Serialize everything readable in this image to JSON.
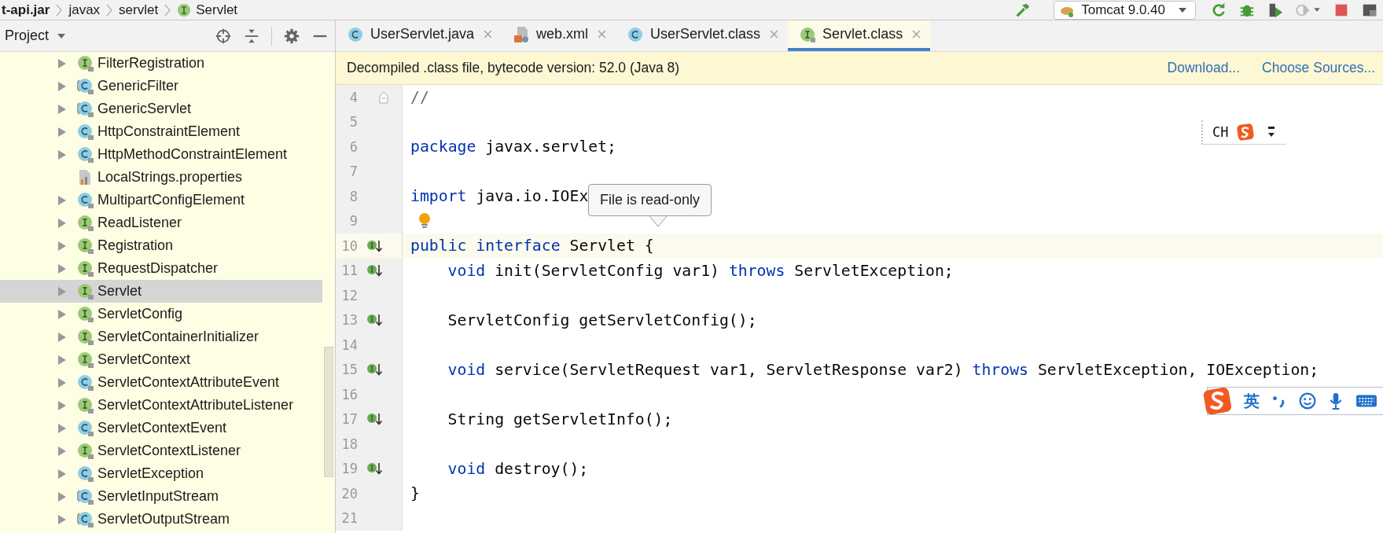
{
  "breadcrumbs": [
    {
      "label": "t-api.jar",
      "kind": "jar"
    },
    {
      "label": "javax",
      "kind": "package"
    },
    {
      "label": "servlet",
      "kind": "package"
    },
    {
      "label": "Servlet",
      "kind": "interface"
    }
  ],
  "run_config": {
    "label": "Tomcat 9.0.40"
  },
  "project_panel": {
    "title": "Project",
    "tree": [
      {
        "label": "FilterRegistration",
        "kind": "interface",
        "selected": false
      },
      {
        "label": "GenericFilter",
        "kind": "abstract",
        "selected": false
      },
      {
        "label": "GenericServlet",
        "kind": "abstract",
        "selected": false
      },
      {
        "label": "HttpConstraintElement",
        "kind": "class",
        "selected": false
      },
      {
        "label": "HttpMethodConstraintElement",
        "kind": "class",
        "selected": false
      },
      {
        "label": "LocalStrings.properties",
        "kind": "properties",
        "selected": false
      },
      {
        "label": "MultipartConfigElement",
        "kind": "class",
        "selected": false
      },
      {
        "label": "ReadListener",
        "kind": "interface",
        "selected": false
      },
      {
        "label": "Registration",
        "kind": "interface",
        "selected": false
      },
      {
        "label": "RequestDispatcher",
        "kind": "interface",
        "selected": false
      },
      {
        "label": "Servlet",
        "kind": "interface",
        "selected": true
      },
      {
        "label": "ServletConfig",
        "kind": "interface",
        "selected": false
      },
      {
        "label": "ServletContainerInitializer",
        "kind": "interface",
        "selected": false
      },
      {
        "label": "ServletContext",
        "kind": "interface",
        "selected": false
      },
      {
        "label": "ServletContextAttributeEvent",
        "kind": "class",
        "selected": false
      },
      {
        "label": "ServletContextAttributeListener",
        "kind": "interface",
        "selected": false
      },
      {
        "label": "ServletContextEvent",
        "kind": "class",
        "selected": false
      },
      {
        "label": "ServletContextListener",
        "kind": "interface",
        "selected": false
      },
      {
        "label": "ServletException",
        "kind": "class",
        "selected": false
      },
      {
        "label": "ServletInputStream",
        "kind": "abstract",
        "selected": false
      },
      {
        "label": "ServletOutputStream",
        "kind": "abstract",
        "selected": false
      }
    ]
  },
  "tabs": [
    {
      "label": "UserServlet.java",
      "kind": "class",
      "selected": false
    },
    {
      "label": "web.xml",
      "kind": "xml",
      "selected": false
    },
    {
      "label": "UserServlet.class",
      "kind": "class",
      "selected": false
    },
    {
      "label": "Servlet.class",
      "kind": "interface",
      "selected": true
    }
  ],
  "banner": {
    "message": "Decompiled .class file, bytecode version: 52.0 (Java 8)",
    "links": [
      "Download...",
      "Choose Sources..."
    ]
  },
  "editor": {
    "lines": [
      {
        "number": "4",
        "current": false,
        "kind": "fold",
        "indent": false,
        "tokens": [
          {
            "text": "//",
            "kind": "comment"
          }
        ]
      },
      {
        "number": "5",
        "current": false
      },
      {
        "number": "6",
        "current": false,
        "indent": false,
        "tokens": [
          {
            "text": "package",
            "kind": "keyword"
          },
          {
            "text": " javax.servlet;",
            "kind": "plain"
          }
        ]
      },
      {
        "number": "7",
        "current": false
      },
      {
        "number": "8",
        "current": false,
        "indent": false,
        "tokens": [
          {
            "text": "import",
            "kind": "keyword"
          },
          {
            "text": " java.io.IOEx",
            "kind": "plain"
          }
        ]
      },
      {
        "number": "9",
        "current": false,
        "kind": "bulb"
      },
      {
        "number": "10",
        "current": true,
        "kind": "implements",
        "indent": false,
        "tokens": [
          {
            "text": "public interface",
            "kind": "keyword"
          },
          {
            "text": " Servlet {",
            "kind": "plain"
          }
        ]
      },
      {
        "number": "11",
        "current": false,
        "kind": "implements",
        "indent": true,
        "tokens": [
          {
            "text": "void",
            "kind": "keyword"
          },
          {
            "text": " init(ServletConfig var1) ",
            "kind": "plain"
          },
          {
            "text": "throws",
            "kind": "keyword"
          },
          {
            "text": " ServletException;",
            "kind": "plain"
          }
        ]
      },
      {
        "number": "12",
        "current": false
      },
      {
        "number": "13",
        "current": false,
        "kind": "implements",
        "indent": true,
        "tokens": [
          {
            "text": "ServletConfig getServletConfig();",
            "kind": "plain"
          }
        ]
      },
      {
        "number": "14",
        "current": false
      },
      {
        "number": "15",
        "current": false,
        "kind": "implements",
        "indent": true,
        "tokens": [
          {
            "text": "void",
            "kind": "keyword"
          },
          {
            "text": " service(ServletRequest var1, ServletResponse var2) ",
            "kind": "plain"
          },
          {
            "text": "throws",
            "kind": "keyword"
          },
          {
            "text": " ServletException, IOException;",
            "kind": "plain"
          }
        ]
      },
      {
        "number": "16",
        "current": false
      },
      {
        "number": "17",
        "current": false,
        "kind": "implements",
        "indent": true,
        "tokens": [
          {
            "text": "String getServletInfo();",
            "kind": "plain"
          }
        ]
      },
      {
        "number": "18",
        "current": false
      },
      {
        "number": "19",
        "current": false,
        "kind": "implements",
        "indent": true,
        "tokens": [
          {
            "text": "void",
            "kind": "keyword"
          },
          {
            "text": " destroy();",
            "kind": "plain"
          }
        ]
      },
      {
        "number": "20",
        "current": false,
        "indent": false,
        "tokens": [
          {
            "text": "}",
            "kind": "plain"
          }
        ]
      },
      {
        "number": "21",
        "current": false
      }
    ]
  },
  "tooltip": {
    "text": "File is read-only"
  },
  "ime_status": {
    "label": "CH"
  },
  "ime_toolbar": {
    "label": "英"
  }
}
